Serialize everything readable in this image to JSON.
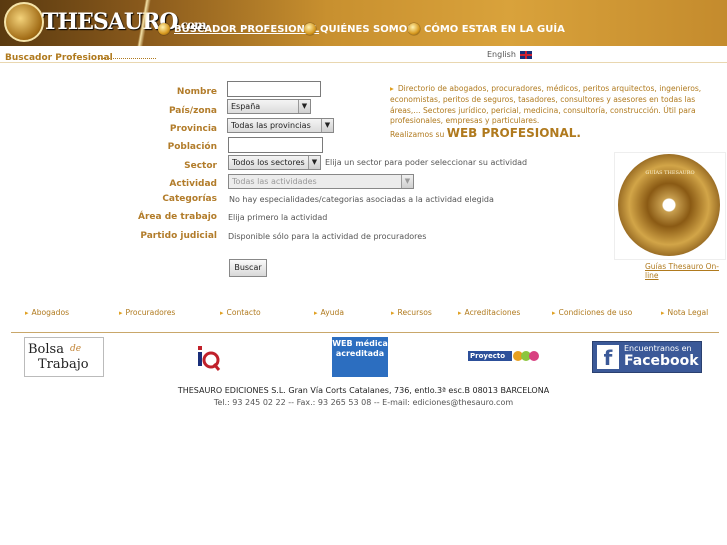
{
  "header": {
    "logo_text": "THESAURO",
    "logo_suffix": ".com",
    "nav": [
      {
        "label": "BUSCADOR PROFESIONAL"
      },
      {
        "label": "QUIÉNES SOMOS"
      },
      {
        "label": "CÓMO ESTAR EN LA GUÍA"
      }
    ]
  },
  "section_title": "Buscador Profesional",
  "language": {
    "label": "English"
  },
  "form": {
    "labels": {
      "nombre": "Nombre",
      "pais": "País/zona",
      "provincia": "Provincia",
      "poblacion": "Población",
      "sector": "Sector",
      "actividad": "Actividad",
      "categorias": "Categorías",
      "area": "Área de trabajo",
      "partido": "Partido judicial"
    },
    "nombre_value": "",
    "pais_selected": "España",
    "provincia_selected": "Todas las provincias",
    "poblacion_value": "",
    "sector_selected": "Todos los sectores",
    "sector_hint": "Elija un sector para poder seleccionar su actividad",
    "actividad_selected": "Todas las actividades",
    "categorias_text": "No hay especialidades/categorias asociadas a la actividad elegida",
    "area_text": "Elija primero la actividad",
    "partido_text": "Disponible sólo para la actividad de procuradores",
    "submit_label": "Buscar"
  },
  "info": {
    "directory_text": "Directorio de abogados, procuradores, médicos, peritos arquitectos, ingenieros, economistas, peritos de seguros, tasadores, consultores y asesores en todas las áreas,... Sectores jurídico, pericial, medicina, consultoría, construcción. Útil para profesionales, empresas y particulares.",
    "realizamos": "Realizamos su",
    "web_profesional": "WEB PROFESIONAL.",
    "cd_title": "GUÍAS THESAURO",
    "guias_link": "Guías Thesauro On-line"
  },
  "footer_nav": [
    {
      "label": "Abogados"
    },
    {
      "label": "Procuradores"
    },
    {
      "label": "Contacto"
    },
    {
      "label": "Ayuda"
    },
    {
      "label": "Recursos"
    },
    {
      "label": "Acreditaciones"
    },
    {
      "label": "Condiciones de uso"
    },
    {
      "label": "Nota Legal"
    }
  ],
  "logos": {
    "bolsa_1": "Bolsa",
    "bolsa_de": "de",
    "bolsa_2": "Trabajo",
    "web_medica": "WEB médica acreditada",
    "proyecto": "Proyecto",
    "facebook_line1": "Encuentranos en",
    "facebook_line2": "Facebook"
  },
  "footer": {
    "address": "THESAURO EDICIONES S.L. Gran Vía Corts Catalanes, 736, entlo.3ª esc.B 08013 BARCELONA",
    "contact": "Tel.: 93 245 02 22 -- Fax.: 93 265 53 08 -- E-mail: ediciones@thesauro.com"
  },
  "colors": {
    "accent": "#b07a1e",
    "header": "#c8902f",
    "facebook": "#3b5998"
  }
}
